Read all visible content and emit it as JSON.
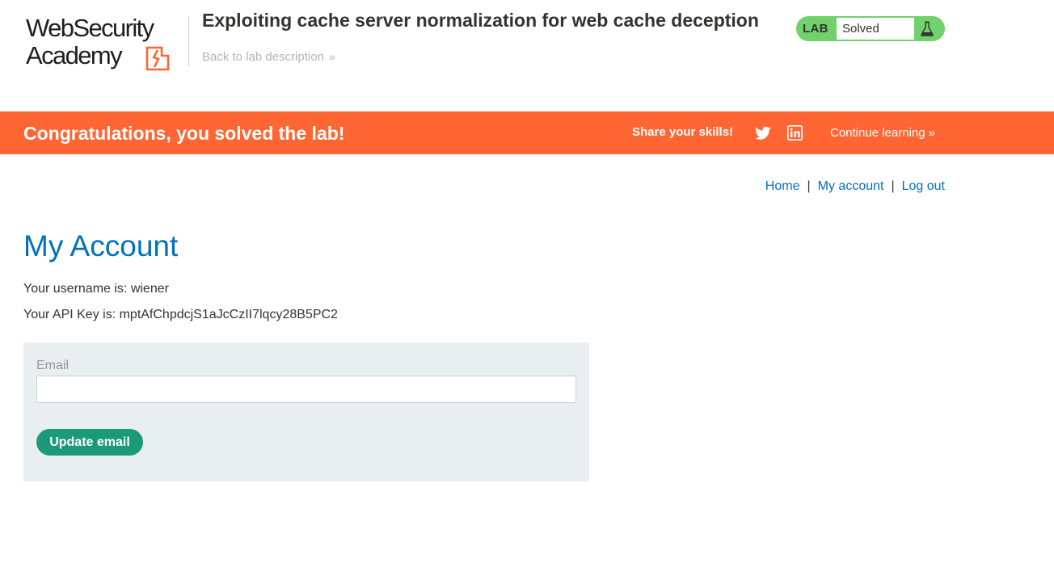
{
  "header": {
    "logo_line1": "WebSecurity",
    "logo_line2": "Academy",
    "lab_title": "Exploiting cache server normalization for web cache deception",
    "back_link": "Back to lab description",
    "lab_badge": "LAB",
    "lab_status": "Solved"
  },
  "banner": {
    "message": "Congratulations, you solved the lab!",
    "share_label": "Share your skills!",
    "continue_label": "Continue learning"
  },
  "nav": {
    "home": "Home",
    "account": "My account",
    "logout": "Log out",
    "separator": "|"
  },
  "main": {
    "title": "My Account",
    "username_line": "Your username is: wiener",
    "apikey_line": "Your API Key is: mptAfChpdcjS1aJcCzII7lqcy28B5PC2",
    "email_label": "Email",
    "email_value": "",
    "update_button": "Update email"
  },
  "icons": {
    "back": "chevron-double-right-icon",
    "flask": "flask-icon",
    "twitter": "twitter-icon",
    "linkedin": "linkedin-icon",
    "continue": "chevron-double-right-icon"
  },
  "colors": {
    "accent_orange": "#ff6633",
    "link_blue": "#0071bc",
    "solved_green": "#70d16d",
    "button_green": "#1a9a78",
    "panel_bg": "#e9eef0"
  }
}
